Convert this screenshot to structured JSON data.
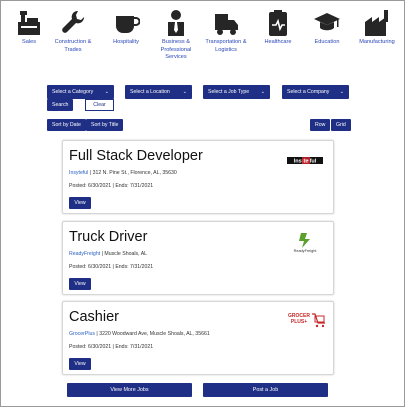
{
  "categories": [
    {
      "label": "Sales",
      "icon": "cash-register-icon"
    },
    {
      "label": "Construction & Trades",
      "icon": "wrench-icon"
    },
    {
      "label": "Hospitality",
      "icon": "coffee-cup-icon"
    },
    {
      "label": "Business & Professional Services",
      "icon": "businessman-icon"
    },
    {
      "label": "Transportation & Logistics",
      "icon": "truck-icon"
    },
    {
      "label": "Healthcare",
      "icon": "medical-clipboard-icon"
    },
    {
      "label": "Education",
      "icon": "graduation-cap-icon"
    },
    {
      "label": "Manufacturing",
      "icon": "factory-icon"
    }
  ],
  "filters": {
    "category": "Select a Category",
    "location": "Select a Location",
    "job_type": "Select a Job Type",
    "company": "Select a Company",
    "search": "Search",
    "clear": "Clear",
    "sort_date": "Sort by Date",
    "sort_title": "Sort by Title",
    "view_row": "Row",
    "view_grid": "Grid"
  },
  "jobs": [
    {
      "title": "Full Stack Developer",
      "company": "Insyteful",
      "address": "312 N. Pine St., Florence, AL, 35630",
      "dates": "Posted: 6/30/2021 | Ends: 7/31/2021",
      "view": "View",
      "logo_text": "Insyteful"
    },
    {
      "title": "Truck Driver",
      "company": "ReadyFreight",
      "address": "Muscle Shoals, AL",
      "dates": "Posted: 6/30/2021 | Ends: 7/31/2021",
      "view": "View",
      "logo_text": "ReadyFreight"
    },
    {
      "title": "Cashier",
      "company": "GrocerPlus",
      "address": "3220 Woodward Ave, Muscle Shoals, AL, 35661",
      "dates": "Posted: 6/30/2021 | Ends: 7/31/2021",
      "view": "View",
      "logo_text": "GROCER PLUS"
    }
  ],
  "footer": {
    "view_more": "View More Jobs",
    "post_job": "Post a Job"
  },
  "colors": {
    "primary": "#1f2f86",
    "link": "#2a47b8",
    "icon": "#262626"
  }
}
